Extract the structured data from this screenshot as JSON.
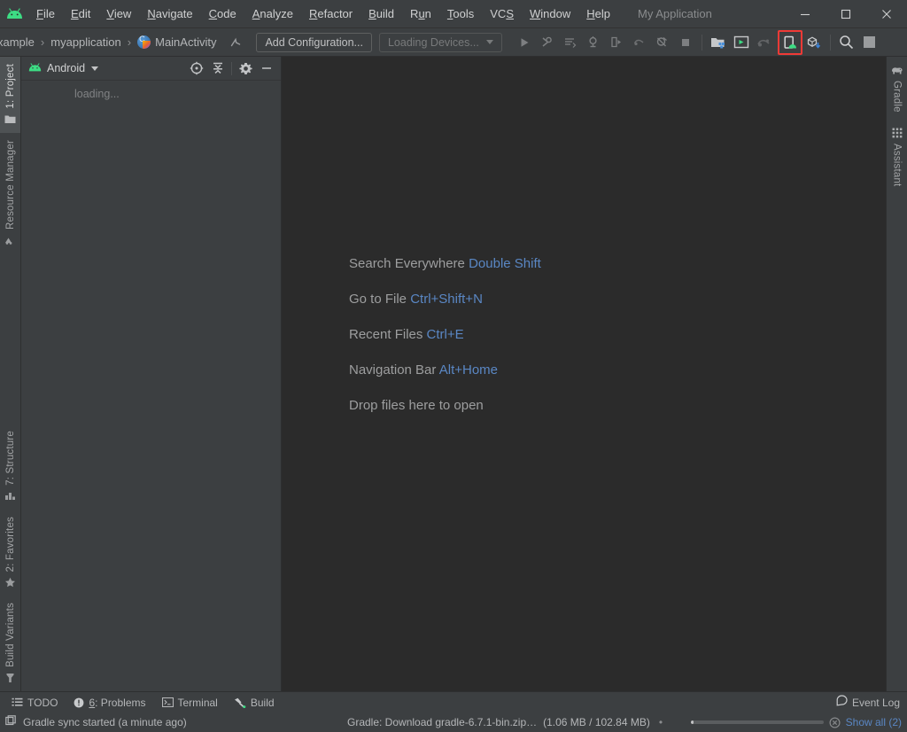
{
  "window": {
    "app_title": "My Application",
    "minimize": "minimize-button",
    "maximize": "maximize-button",
    "close": "close-button"
  },
  "menubar": {
    "logo": "android-logo",
    "items": [
      {
        "label": "File",
        "mnemonic": "F"
      },
      {
        "label": "Edit",
        "mnemonic": "E"
      },
      {
        "label": "View",
        "mnemonic": "V"
      },
      {
        "label": "Navigate",
        "mnemonic": "N"
      },
      {
        "label": "Code",
        "mnemonic": "C"
      },
      {
        "label": "Analyze",
        "mnemonic": "A"
      },
      {
        "label": "Refactor",
        "mnemonic": "R"
      },
      {
        "label": "Build",
        "mnemonic": "B"
      },
      {
        "label": "Run",
        "mnemonic": "u"
      },
      {
        "label": "Tools",
        "mnemonic": "T"
      },
      {
        "label": "VCS",
        "mnemonic": "S"
      },
      {
        "label": "Window",
        "mnemonic": "W"
      },
      {
        "label": "Help",
        "mnemonic": "H"
      }
    ]
  },
  "navbar": {
    "crumbs": [
      "xample",
      "myapplication",
      "MainActivity"
    ],
    "separator": "›",
    "file_icon": "kotlin-class-icon",
    "back_icon": "navigate-up-icon",
    "add_configuration": "Add Configuration...",
    "device_selector": "Loading Devices...",
    "icons": [
      "run-icon",
      "debug-icon",
      "run-with-coverage-icon",
      "profiler-icon",
      "apply-changes-icon",
      "apply-code-changes-icon",
      "attach-debugger-icon",
      "stop-icon",
      "sdk-manager-icon",
      "avd-manager-icon",
      "layout-inspector-icon",
      "device-file-explorer-icon",
      "sdk-update-icon",
      "search-icon",
      "settings-icon"
    ],
    "highlighted_icon": "avd-manager-icon"
  },
  "left_stripe": {
    "top": [
      {
        "label": "1: Project",
        "icon": "project-folder-icon",
        "active": true
      },
      {
        "label": "Resource Manager",
        "icon": "resource-manager-icon",
        "active": false
      }
    ],
    "bottom": [
      {
        "label": "7: Structure",
        "icon": "structure-icon",
        "active": false
      },
      {
        "label": "2: Favorites",
        "icon": "star-icon",
        "active": false
      },
      {
        "label": "Build Variants",
        "icon": "build-variants-icon",
        "active": false
      }
    ]
  },
  "right_stripe": {
    "top": [
      {
        "label": "Gradle",
        "icon": "gradle-elephant-icon"
      },
      {
        "label": "Assistant",
        "icon": "assistant-grid-icon"
      }
    ]
  },
  "project_panel": {
    "view_selector": "Android",
    "view_icon": "android-head-icon",
    "actions": [
      "select-opened-file-icon",
      "collapse-all-icon",
      "settings-gear-icon",
      "hide-icon"
    ],
    "content_text": "loading..."
  },
  "editor": {
    "hints": [
      {
        "action": "Search Everywhere",
        "shortcut": "Double Shift"
      },
      {
        "action": "Go to File",
        "shortcut": "Ctrl+Shift+N"
      },
      {
        "action": "Recent Files",
        "shortcut": "Ctrl+E"
      },
      {
        "action": "Navigation Bar",
        "shortcut": "Alt+Home"
      },
      {
        "action": "Drop files here to open",
        "shortcut": ""
      }
    ]
  },
  "toolwindow_bar": {
    "buttons": [
      {
        "label": "TODO",
        "icon": "todo-list-icon",
        "mnemonic": ""
      },
      {
        "label": "6: Problems",
        "icon": "problems-warning-icon",
        "mnemonic": "6"
      },
      {
        "label": "Terminal",
        "icon": "terminal-icon",
        "mnemonic": ""
      },
      {
        "label": "Build",
        "icon": "build-hammer-icon",
        "mnemonic": ""
      }
    ],
    "event_log": "Event Log",
    "event_log_icon": "event-log-icon"
  },
  "statusbar": {
    "memory_icon": "ide-status-icon",
    "message": "Gradle sync started (a minute ago)",
    "task_text": "Gradle: Download gradle-6.7.1-bin.zip…",
    "task_progress_text": "(1.06 MB / 102.84 MB)",
    "separator_dot": "•",
    "progress_percent": 1,
    "cancel_icon": "cancel-task-icon",
    "show_all": "Show all (2)"
  },
  "colors": {
    "panel_bg": "#3c3f41",
    "editor_bg": "#2b2b2b",
    "text": "#b4b6b8",
    "link_blue": "#5a87c4",
    "highlight_red": "#f03a36",
    "android_green": "#3ddc84"
  }
}
